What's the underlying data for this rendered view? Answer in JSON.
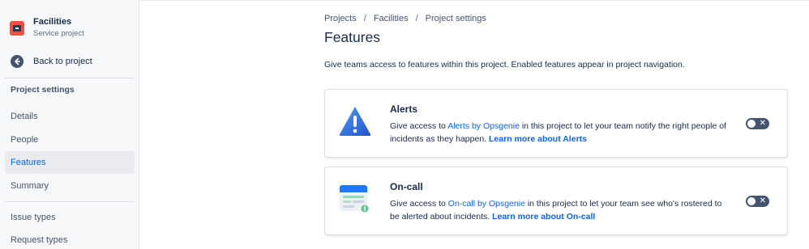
{
  "sidebar": {
    "project_name": "Facilities",
    "project_type": "Service project",
    "back_label": "Back to project",
    "section_title": "Project settings",
    "items": [
      {
        "label": "Details"
      },
      {
        "label": "People"
      },
      {
        "label": "Features",
        "active": true
      },
      {
        "label": "Summary"
      },
      {
        "label": "Issue types"
      },
      {
        "label": "Request types"
      }
    ]
  },
  "breadcrumb": [
    "Projects",
    "Facilities",
    "Project settings"
  ],
  "breadcrumb_separator": "/",
  "page_title": "Features",
  "description": "Give teams access to features within this project. Enabled features appear in project navigation.",
  "features": [
    {
      "title": "Alerts",
      "icon": "warning-triangle-icon",
      "text_before": "Give access to ",
      "link_text": "Alerts by Opsgenie",
      "text_after": " in this project to let your team notify the right people of incidents as they happen. ",
      "learn_more": "Learn more about Alerts",
      "enabled": false,
      "toggle_symbol": "✕"
    },
    {
      "title": "On-call",
      "icon": "calendar-icon",
      "text_before": "Give access to ",
      "link_text": "On-call by Opsgenie",
      "text_after": " in this project to let your team see who's rostered to be alerted about incidents. ",
      "learn_more": "Learn more about On-call",
      "enabled": false,
      "toggle_symbol": "✕"
    }
  ],
  "colors": {
    "link": "#0c66e4",
    "active_nav_bg": "#e9ebee",
    "toggle_off": "#44546f",
    "project_avatar": "#e5553f"
  }
}
